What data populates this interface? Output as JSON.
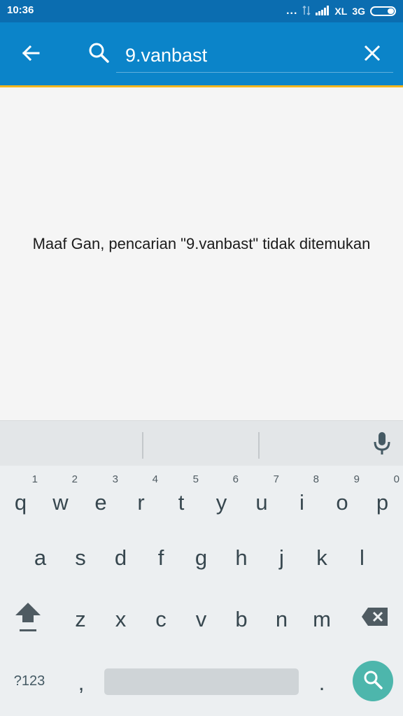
{
  "status_bar": {
    "time": "10:36",
    "dots": "...",
    "carrier": "XL",
    "network": "3G",
    "icons": [
      "data-arrows-icon",
      "signal-icon",
      "battery-icon"
    ]
  },
  "search": {
    "query": "9.vanbast",
    "icons": {
      "back": "arrow-left-icon",
      "search": "search-icon",
      "clear": "close-icon"
    }
  },
  "content": {
    "empty_message": "Maaf Gan, pencarian \"9.vanbast\" tidak ditemukan"
  },
  "keyboard": {
    "row1": [
      {
        "key": "q",
        "hint": "1"
      },
      {
        "key": "w",
        "hint": "2"
      },
      {
        "key": "e",
        "hint": "3"
      },
      {
        "key": "r",
        "hint": "4"
      },
      {
        "key": "t",
        "hint": "5"
      },
      {
        "key": "y",
        "hint": "6"
      },
      {
        "key": "u",
        "hint": "7"
      },
      {
        "key": "i",
        "hint": "8"
      },
      {
        "key": "o",
        "hint": "9"
      },
      {
        "key": "p",
        "hint": "0"
      }
    ],
    "row2": [
      "a",
      "s",
      "d",
      "f",
      "g",
      "h",
      "j",
      "k",
      "l"
    ],
    "row3": [
      "z",
      "x",
      "c",
      "v",
      "b",
      "n",
      "m"
    ],
    "symbols_label": "?123",
    "comma": ",",
    "period": ".",
    "icons": {
      "shift": "shift-icon",
      "backspace": "backspace-icon",
      "mic": "mic-icon",
      "action": "search-icon"
    }
  },
  "colors": {
    "status_bar": "#0b6db0",
    "app_bar": "#0b84c9",
    "accent_line": "#f2b61e",
    "action_key": "#4db6ac",
    "key_text": "#37474f"
  }
}
